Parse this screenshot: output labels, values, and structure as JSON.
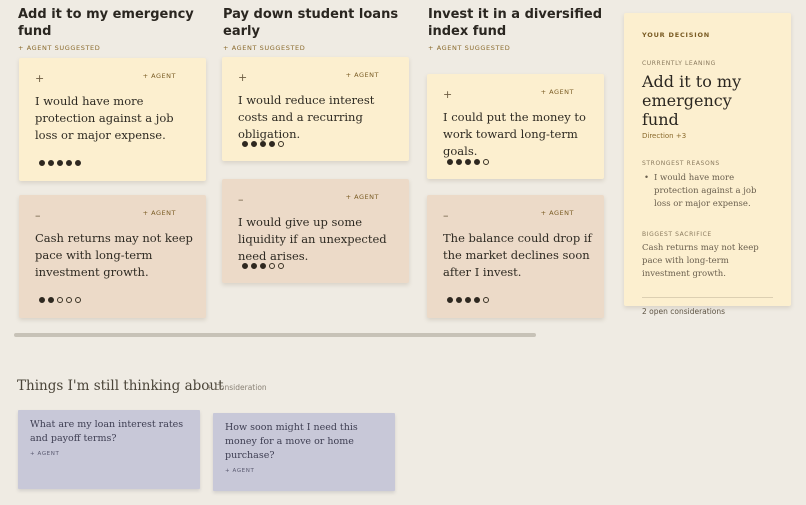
{
  "columns": [
    {
      "title": "Add it to my emergency fund",
      "tag": "+ Agent suggested",
      "pro": {
        "sign": "+",
        "agent": "+ Agent",
        "text": "I would have more protection against a job loss or major expense.",
        "rating": 5
      },
      "con": {
        "sign": "–",
        "agent": "+ Agent",
        "text": "Cash returns may not keep pace with long-term investment growth.",
        "rating": 2
      }
    },
    {
      "title": "Pay down student loans early",
      "tag": "+ Agent suggested",
      "pro": {
        "sign": "+",
        "agent": "+ Agent",
        "text": "I would reduce interest costs and a recurring obligation.",
        "rating": 4
      },
      "con": {
        "sign": "–",
        "agent": "+ Agent",
        "text": "I would give up some liquidity if an unexpected need arises.",
        "rating": 3
      }
    },
    {
      "title": "Invest it in a diversified index fund",
      "tag": "+ Agent suggested",
      "pro": {
        "sign": "+",
        "agent": "+ Agent",
        "text": "I could put the money to work toward long-term goals.",
        "rating": 4
      },
      "con": {
        "sign": "–",
        "agent": "+ Agent",
        "text": "The balance could drop if the market declines soon after I invest.",
        "rating": 4
      }
    }
  ],
  "rating_max": 5,
  "decision": {
    "label": "Your decision",
    "leaning_label": "Currently leaning",
    "leaning": "Add it to my emergency fund",
    "direction": "Direction +3",
    "reasons_label": "Strongest reasons",
    "reasons": [
      "I would have more protection against a job loss or major expense."
    ],
    "sacrifice_label": "Biggest sacrifice",
    "sacrifice": "Cash returns may not keep pace with long-term investment growth.",
    "open_count": "2 open considerations"
  },
  "thinking": {
    "title": "Things I'm still thinking about",
    "add_label": "+ Consideration",
    "items": [
      {
        "text": "What are my loan interest rates and payoff terms?",
        "agent": "+ Agent"
      },
      {
        "text": "How soon might I need this money for a move or home purchase?",
        "agent": "+ Agent"
      }
    ]
  }
}
